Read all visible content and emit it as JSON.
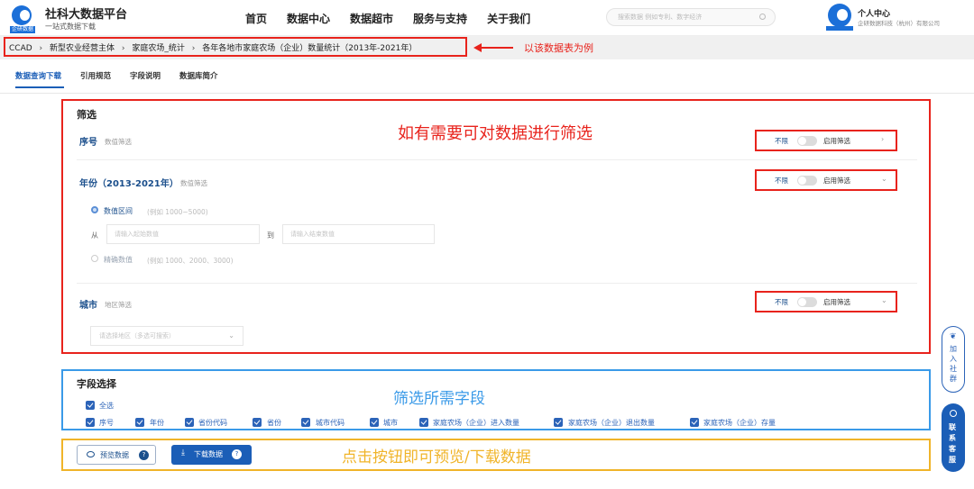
{
  "brand": {
    "title": "社科大数据平台",
    "subtitle": "一站式数据下载",
    "tag": "企研数据"
  },
  "nav": [
    "首页",
    "数据中心",
    "数据超市",
    "服务与支持",
    "关于我们"
  ],
  "search": {
    "placeholder": "搜索数据 例如专利、数字经济"
  },
  "user": {
    "name": "个人中心",
    "org": "企研数据科技（杭州）有限公司"
  },
  "breadcrumb": [
    "CCAD",
    "新型农业经营主体",
    "家庭农场_统计",
    "各年各地市家庭农场（企业）数量统计（2013年-2021年）"
  ],
  "breadcrumb_note": "以该数据表为例",
  "tabs": [
    "数据查询下载",
    "引用规范",
    "字段说明",
    "数据库简介"
  ],
  "filter": {
    "title": "筛选",
    "note": "如有需要可对数据进行筛选",
    "toggle_off": "不限",
    "toggle_on": "启用筛选",
    "rows": [
      {
        "label": "序号",
        "hint": "数值筛选"
      },
      {
        "label": "年份（2013-2021年）",
        "hint": "数值筛选"
      },
      {
        "label": "城市",
        "hint": "地区筛选"
      }
    ],
    "range": {
      "label": "数值区间",
      "hint": "(例如 1000~5000)",
      "from": "从",
      "to": "到",
      "start_placeholder": "请输入起始数值",
      "end_placeholder": "请输入结束数值"
    },
    "exact": {
      "label": "精确数值",
      "hint": "(例如 1000、2000、3000)"
    },
    "region_placeholder": "请选择地区（多选可搜索）"
  },
  "fields": {
    "title": "字段选择",
    "note": "筛选所需字段",
    "select_all": "全选",
    "items": [
      "序号",
      "年份",
      "省份代码",
      "省份",
      "城市代码",
      "城市",
      "家庭农场（企业）进入数量",
      "家庭农场（企业）退出数量",
      "家庭农场（企业）存量"
    ]
  },
  "actions": {
    "preview": "预览数据",
    "download": "下载数据",
    "help": "?",
    "note": "点击按钮即可预览/下载数据"
  },
  "side": {
    "join": "加入社群",
    "service": "联系客服"
  },
  "colors": {
    "brand": "#1b5eb7",
    "annotation_red": "#e8231c",
    "annotation_blue": "#3a9ae8",
    "annotation_yellow": "#f0b429"
  }
}
